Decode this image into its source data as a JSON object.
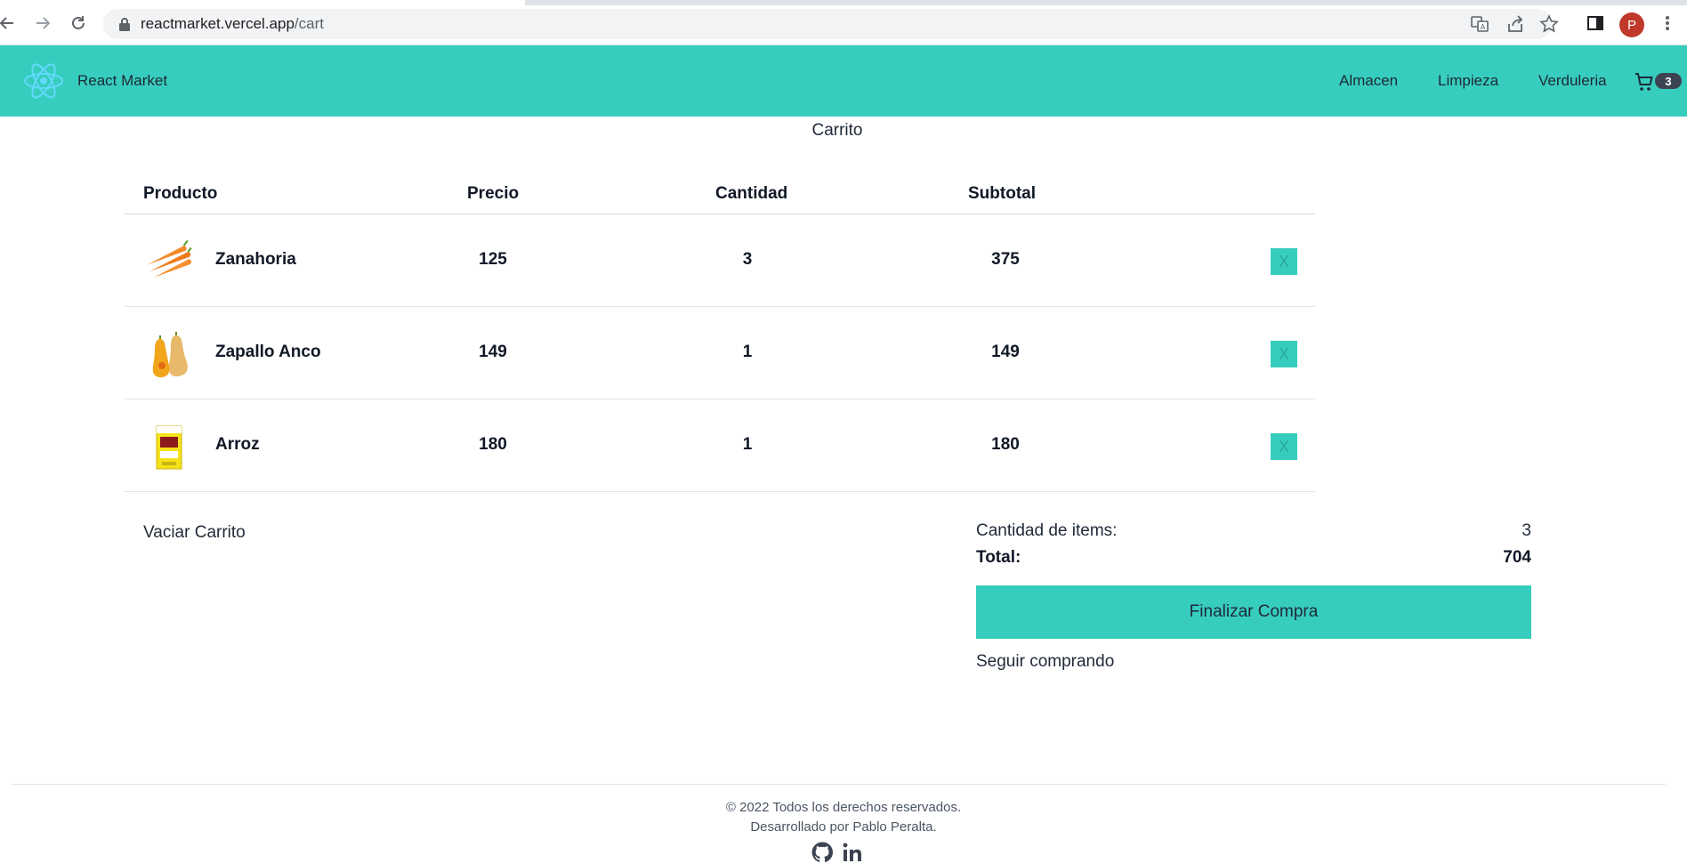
{
  "browser": {
    "url_host": "reactmarket.vercel.app",
    "url_path": "/cart",
    "profile_initial": "P"
  },
  "navbar": {
    "brand": "React Market",
    "links": [
      "Almacen",
      "Limpieza",
      "Verduleria"
    ],
    "cart_count": "3"
  },
  "cart": {
    "title": "Carrito",
    "columns": [
      "Producto",
      "Precio",
      "Cantidad",
      "Subtotal"
    ],
    "items": [
      {
        "name": "Zanahoria",
        "price": "125",
        "qty": "3",
        "subtotal": "375",
        "remove": "X",
        "icon": "carrot-image"
      },
      {
        "name": "Zapallo Anco",
        "price": "149",
        "qty": "1",
        "subtotal": "149",
        "remove": "X",
        "icon": "butternut-squash-image"
      },
      {
        "name": "Arroz",
        "price": "180",
        "qty": "1",
        "subtotal": "180",
        "remove": "X",
        "icon": "rice-box-image"
      }
    ],
    "clear_label": "Vaciar Carrito",
    "summary": {
      "items_label": "Cantidad de items:",
      "items_value": "3",
      "total_label": "Total:",
      "total_value": "704"
    },
    "checkout_label": "Finalizar Compra",
    "continue_label": "Seguir comprando"
  },
  "footer": {
    "copyright": "© 2022 Todos los derechos reservados.",
    "credit": "Desarrollado por Pablo Peralta."
  },
  "colors": {
    "accent": "#37cdbe",
    "badge": "#3d4451",
    "profile": "#c0392b"
  }
}
